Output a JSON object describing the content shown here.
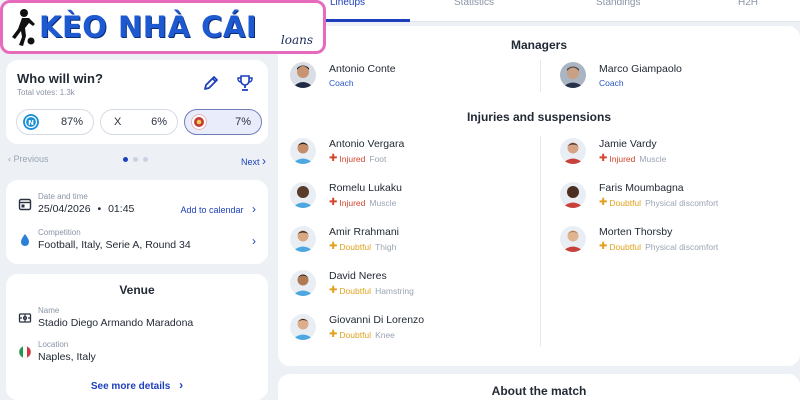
{
  "logo": {
    "title": "KÈO NHÀ CÁI",
    "subtitle": "loans"
  },
  "tabs": [
    "Lineups",
    "Statistics",
    "Standings",
    "H2H"
  ],
  "poll": {
    "title": "Who will win?",
    "total_votes": "Total votes: 1.3k",
    "options": [
      {
        "label": "",
        "pct": "87%"
      },
      {
        "label": "X",
        "pct": "6%"
      },
      {
        "label": "",
        "pct": "7%"
      }
    ]
  },
  "pager": {
    "prev": "Previous",
    "next": "Next"
  },
  "details": {
    "date_label": "Date and time",
    "date_value": "25/04/2026",
    "time_value": "01:45",
    "add_calendar": "Add to calendar",
    "competition_label": "Competition",
    "competition_value": "Football, Italy, Serie A, Round 34"
  },
  "venue": {
    "title": "Venue",
    "name_label": "Name",
    "name_value": "Stadio Diego Armando Maradona",
    "location_label": "Location",
    "location_value": "Naples, Italy",
    "see_more": "See more details"
  },
  "managers": {
    "title": "Managers",
    "home": {
      "name": "Antonio Conte",
      "role": "Coach"
    },
    "away": {
      "name": "Marco Giampaolo",
      "role": "Coach"
    }
  },
  "injuries": {
    "title": "Injuries and suspensions",
    "home": [
      {
        "name": "Antonio Vergara",
        "status": "Injured",
        "reason": "Foot"
      },
      {
        "name": "Romelu Lukaku",
        "status": "Injured",
        "reason": "Muscle"
      },
      {
        "name": "Amir Rrahmani",
        "status": "Doubtful",
        "reason": "Thigh"
      },
      {
        "name": "David Neres",
        "status": "Doubtful",
        "reason": "Hamstring"
      },
      {
        "name": "Giovanni Di Lorenzo",
        "status": "Doubtful",
        "reason": "Knee"
      }
    ],
    "away": [
      {
        "name": "Jamie Vardy",
        "status": "Injured",
        "reason": "Muscle"
      },
      {
        "name": "Faris Moumbagna",
        "status": "Doubtful",
        "reason": "Physical discomfort"
      },
      {
        "name": "Morten Thorsby",
        "status": "Doubtful",
        "reason": "Physical discomfort"
      }
    ]
  },
  "about": {
    "title": "About the match"
  },
  "colors": {
    "accent": "#1d3fbb",
    "injured": "#d2462e",
    "doubtful": "#e0a21e",
    "background": "#edf1f6"
  }
}
